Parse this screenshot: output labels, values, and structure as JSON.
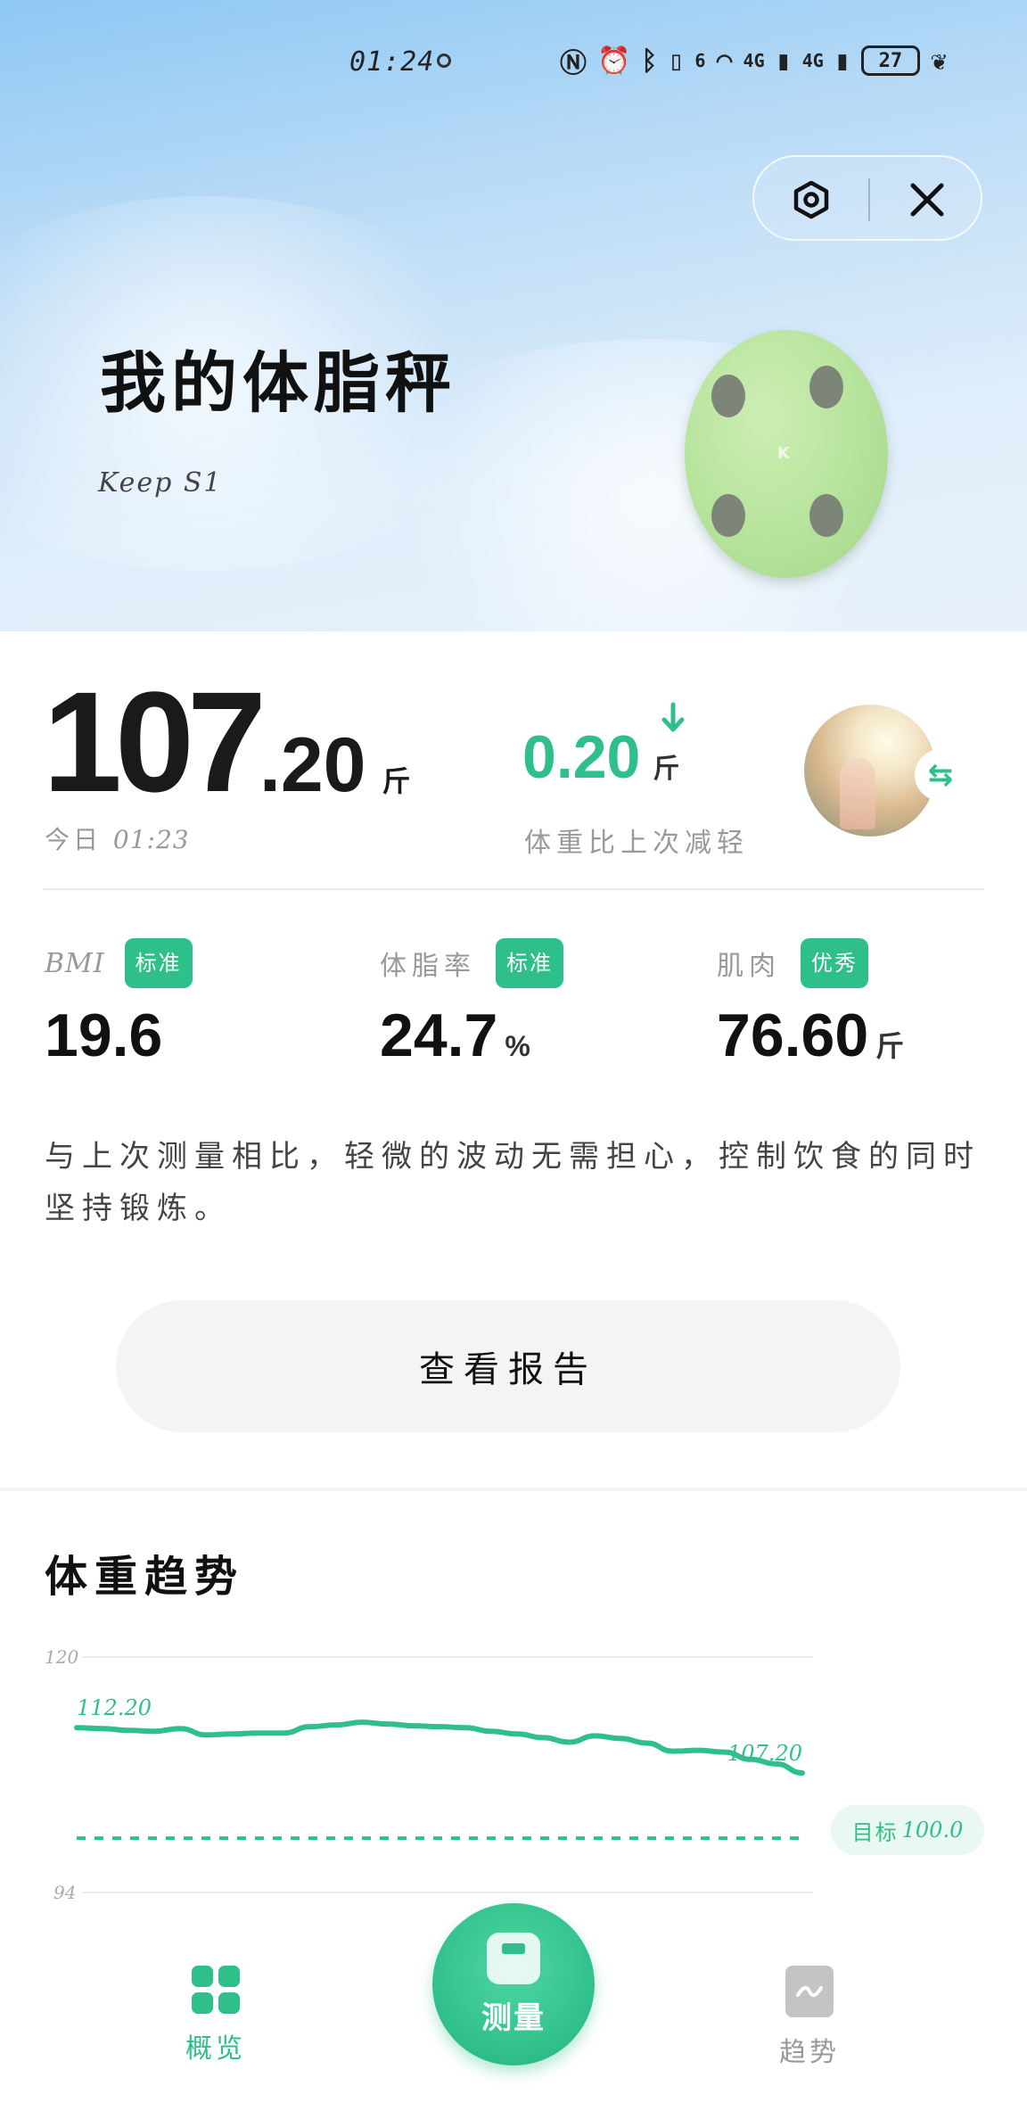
{
  "status_bar": {
    "time": "01:24",
    "network_1": "4G",
    "network_2": "4G",
    "wifi_badge": "6",
    "battery": "27"
  },
  "header": {
    "title": "我的体脂秤",
    "device_model": "Keep S1",
    "scale_logo": "K"
  },
  "weight": {
    "integer": "107",
    "decimal": ".20",
    "unit": "斤",
    "date_label": "今日",
    "time": "01:23"
  },
  "change": {
    "value": "0.20",
    "unit": "斤",
    "direction": "down",
    "label": "体重比上次减轻"
  },
  "metrics": [
    {
      "label": "BMI",
      "tag": "标准",
      "value": "19.6",
      "unit": ""
    },
    {
      "label": "体脂率",
      "tag": "标准",
      "value": "24.7",
      "unit": "%"
    },
    {
      "label": "肌肉",
      "tag": "优秀",
      "value": "76.60",
      "unit": "斤"
    }
  ],
  "advice": "与上次测量相比，轻微的波动无需担心，控制饮食的同时坚持锻炼。",
  "report_button": "查看报告",
  "trend": {
    "title": "体重趋势",
    "goal_label": "目标",
    "goal_value": "100.0"
  },
  "chart_data": {
    "type": "line",
    "ylim": [
      94,
      120
    ],
    "y_ticks": [
      "120",
      "94"
    ],
    "series": [
      {
        "values": [
          112.2,
          112.1,
          111.9,
          111.8,
          112.1,
          111.4,
          111.5,
          111.6,
          111.6,
          112.3,
          112.5,
          112.8,
          112.6,
          112.4,
          112.3,
          112.2,
          111.8,
          111.5,
          111.1,
          110.6,
          111.3,
          111.0,
          110.5,
          109.6,
          109.7,
          109.5,
          108.7,
          108.2,
          107.2
        ]
      }
    ],
    "start_label": "112.20",
    "end_label": "107.20",
    "goal": 100.0,
    "colors": {
      "line": "#2fbf8a",
      "grid": "#eeeeee"
    }
  },
  "nav": {
    "overview": "概览",
    "measure": "测量",
    "trend": "趋势"
  },
  "colors": {
    "accent": "#2fbf8a",
    "muted_text": "#999999"
  }
}
